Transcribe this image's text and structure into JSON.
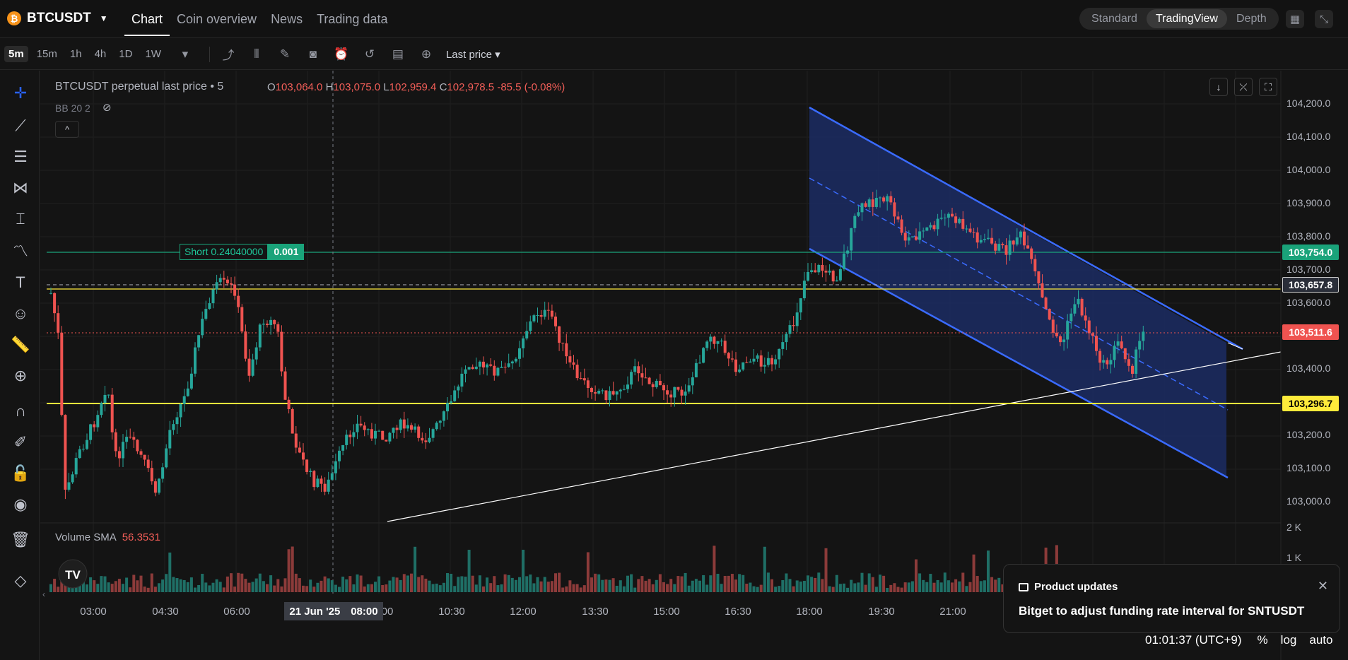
{
  "header": {
    "symbol": "BTCUSDT",
    "coin_glyph": "₿",
    "tabs": [
      "Chart",
      "Coin overview",
      "News",
      "Trading data"
    ],
    "view_options": [
      "Standard",
      "TradingView",
      "Depth"
    ]
  },
  "toolbar": {
    "timeframes": [
      "5m",
      "15m",
      "1h",
      "4h",
      "1D",
      "1W"
    ],
    "price_source": "Last price"
  },
  "legend": {
    "title": "BTCUSDT perpetual last price • 5",
    "o_label": "O",
    "o": "103,064.0",
    "h_label": "H",
    "h": "103,075.0",
    "l_label": "L",
    "l": "102,959.4",
    "c_label": "C",
    "c": "102,978.5",
    "change": "-85.5 (-0.08%)",
    "bb": "BB 20 2",
    "volume_label": "Volume SMA",
    "volume_value": "56.3531"
  },
  "order": {
    "side_label": "Short 0.24040000",
    "qty": "0.001"
  },
  "price_axis": {
    "ticks": [
      "104,200.0",
      "104,100.0",
      "104,000.0",
      "103,900.0",
      "103,800.0",
      "103,700.0",
      "103,600.0",
      "103,400.0",
      "103,200.0",
      "103,100.0",
      "103,000.0"
    ],
    "volume_ticks": [
      "2 K",
      "1 K"
    ],
    "badges": {
      "order_line": "103,754.0",
      "marker": "103,657.8",
      "last_price": "103,511.6",
      "support": "103,296.7"
    }
  },
  "time_axis": {
    "ticks": [
      "03:00",
      "04:30",
      "06:00",
      "10:30",
      "12:00",
      "13:30",
      "15:00",
      "16:30",
      "18:00",
      "19:30",
      "21:00"
    ],
    "crosshair_date": "21 Jun '25",
    "crosshair_time": "08:00",
    "hidden_tick_fragment": "00"
  },
  "popup": {
    "title": "Product updates",
    "message": "Bitget to adjust funding rate interval for SNTUSDT"
  },
  "footer": {
    "clock": "01:01:37 (UTC+9)",
    "percent": "%",
    "log": "log",
    "auto": "auto"
  },
  "colors": {
    "up": "#26a69a",
    "down": "#ef5350",
    "channel": "#2962ff",
    "support": "#ffeb3b",
    "order": "#1aa37a"
  }
}
